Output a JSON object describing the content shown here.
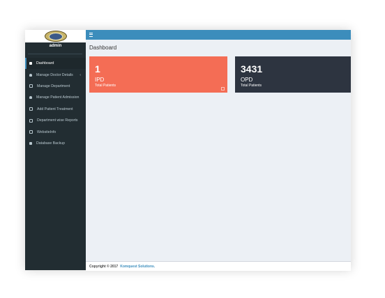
{
  "app": {
    "user": "admin"
  },
  "sidebar": {
    "items": [
      {
        "label": "Dashboard",
        "icon": "calendar-icon",
        "active": true
      },
      {
        "label": "Manage Doctor Details",
        "icon": "user-icon",
        "has_chevron": true
      },
      {
        "label": "Manage Department",
        "icon": "file-icon"
      },
      {
        "label": "Manage Patient Admission",
        "icon": "user-icon"
      },
      {
        "label": "Add Patient Treatment",
        "icon": "calendar-icon"
      },
      {
        "label": "Department wise Reports",
        "icon": "line-chart-icon"
      },
      {
        "label": "WebsiteInfo",
        "icon": "file-icon"
      },
      {
        "label": "Database Backup",
        "icon": "database-icon"
      }
    ],
    "chevron": "‹"
  },
  "header": {
    "menu_icon": "hamburger-icon",
    "accent": "#3c8dbc"
  },
  "main": {
    "title": "Dashboard",
    "cards": [
      {
        "count": "1",
        "label": "IPD",
        "sub": "Total Patients",
        "color": "#f46d55"
      },
      {
        "count": "3431",
        "label": "OPD",
        "sub": "Total Patients",
        "color": "#2d3440"
      }
    ]
  },
  "footer": {
    "copyright": "Copyright © 2017",
    "company": "Komquest Solutions."
  }
}
